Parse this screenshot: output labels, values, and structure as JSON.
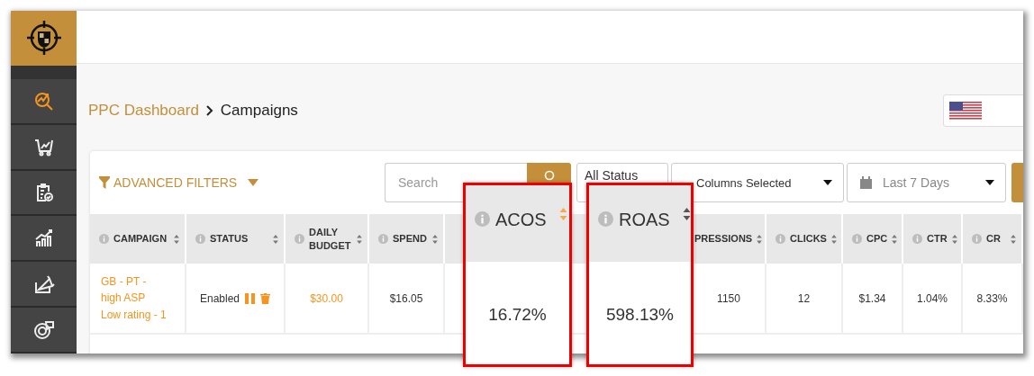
{
  "sidebar": {
    "items": [
      {
        "selected": true
      },
      {
        "selected": false
      },
      {
        "selected": false
      },
      {
        "selected": false
      },
      {
        "selected": false
      },
      {
        "selected": false
      }
    ]
  },
  "breadcrumb": {
    "parent": "PPC Dashboard",
    "current": "Campaigns"
  },
  "filters": {
    "advanced_label": "ADVANCED FILTERS",
    "search": {
      "placeholder": "Search"
    },
    "status": "All Status",
    "columns": "Columns Selected",
    "date": "Last 7 Days"
  },
  "table": {
    "columns": [
      {
        "label": "CAMPAIGN",
        "kind": "link"
      },
      {
        "label": "STATUS",
        "kind": "status"
      },
      {
        "label": "DAILY BUDGET",
        "kind": "editable"
      },
      {
        "label": "SPEND",
        "kind": "plain"
      },
      {
        "label": "PRESSIONS",
        "kind": "cut"
      },
      {
        "label": "CLICKS",
        "kind": "plain"
      },
      {
        "label": "CPC",
        "kind": "plain"
      },
      {
        "label": "CTR",
        "kind": "plain"
      },
      {
        "label": "CR",
        "kind": "plain"
      }
    ],
    "rows": [
      {
        "cells": [
          "GB - PT - high ASP Low rating - 1",
          "Enabled",
          "$30.00",
          "$16.05",
          "1150",
          "12",
          "$1.34",
          "1.04%",
          "8.33%"
        ]
      }
    ]
  },
  "callouts": [
    {
      "label": "ACOS",
      "value": "16.72%",
      "sorted": true
    },
    {
      "label": "ROAS",
      "value": "598.13%",
      "sorted": false
    }
  ]
}
